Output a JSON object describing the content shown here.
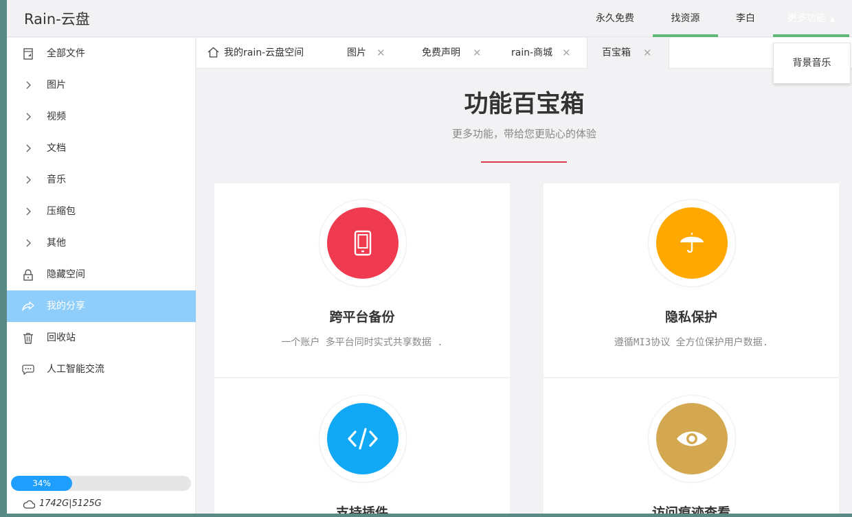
{
  "app": {
    "title": "Rain-云盘"
  },
  "nav": {
    "items": [
      {
        "label": "永久免费",
        "active": false
      },
      {
        "label": "找资源",
        "active": true
      },
      {
        "label": "李白",
        "active": false
      },
      {
        "label": "更多功能",
        "active": true
      }
    ],
    "dropdown": {
      "items": [
        "背景音乐"
      ]
    }
  },
  "sidebar": {
    "items": [
      {
        "label": "全部文件",
        "icon": "file-icon"
      },
      {
        "label": "图片",
        "icon": "chevron-right-icon"
      },
      {
        "label": "视频",
        "icon": "chevron-right-icon"
      },
      {
        "label": "文档",
        "icon": "chevron-right-icon"
      },
      {
        "label": "音乐",
        "icon": "chevron-right-icon"
      },
      {
        "label": "压缩包",
        "icon": "chevron-right-icon"
      },
      {
        "label": "其他",
        "icon": "chevron-right-icon"
      },
      {
        "label": "隐藏空间",
        "icon": "lock-icon"
      },
      {
        "label": "我的分享",
        "icon": "share-icon",
        "active": true
      },
      {
        "label": "回收站",
        "icon": "trash-icon"
      },
      {
        "label": "人工智能交流",
        "icon": "chat-icon"
      }
    ],
    "storage": {
      "percent_label": "34%",
      "percent": 34,
      "quota": "1742G|5125G"
    }
  },
  "tabs": [
    {
      "label": "我的rain-云盘空间",
      "home": true,
      "closable": false
    },
    {
      "label": "图片",
      "closable": true
    },
    {
      "label": "免费声明",
      "closable": true
    },
    {
      "label": "rain-商城",
      "closable": true
    },
    {
      "label": "百宝箱",
      "closable": true,
      "active": true
    }
  ],
  "tab_close_glyph": "✕",
  "main": {
    "title": "功能百宝箱",
    "subtitle": "更多功能，带给您更贴心的体验",
    "accent_color": "#d9384a",
    "cards": [
      {
        "title": "跨平台备份",
        "desc": "一个账户 多平台同时实式共享数据 .",
        "icon": "tablet-icon",
        "color": "#f03a4f"
      },
      {
        "title": "隐私保护",
        "desc": "遵循MI3协议 全方位保护用户数据.",
        "icon": "umbrella-icon",
        "color": "#ffa800"
      },
      {
        "title": "支持插件",
        "desc": "",
        "icon": "code-icon",
        "color": "#11a8f6"
      },
      {
        "title": "访问痕迹查看",
        "desc": "",
        "icon": "eye-icon",
        "color": "#d4a850"
      }
    ]
  }
}
